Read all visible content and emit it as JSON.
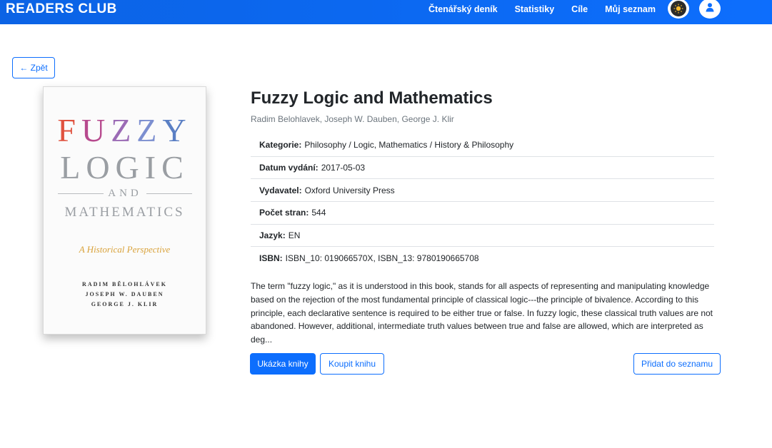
{
  "nav": {
    "brand": "READERS CLUB",
    "links": [
      "Čtenářský deník",
      "Statistiky",
      "Cíle",
      "Můj seznam"
    ]
  },
  "back_label": "← Zpět",
  "cover": {
    "word1": "FUZZY",
    "word2": "LOGIC",
    "word3": "AND",
    "word4": "MATHEMATICS",
    "subtitle": "A Historical Perspective",
    "authors": [
      "RADIM BĚLOHLÁVEK",
      "JOSEPH W. DAUBEN",
      "GEORGE J. KLIR"
    ]
  },
  "book": {
    "title": "Fuzzy Logic and Mathematics",
    "authors": "Radim Belohlavek, Joseph W. Dauben, George J. Klir",
    "details": [
      {
        "label": "Kategorie:",
        "value": "Philosophy / Logic, Mathematics / History & Philosophy"
      },
      {
        "label": "Datum vydání:",
        "value": "2017-05-03"
      },
      {
        "label": "Vydavatel:",
        "value": "Oxford University Press"
      },
      {
        "label": "Počet stran:",
        "value": "544"
      },
      {
        "label": "Jazyk:",
        "value": "EN"
      },
      {
        "label": "ISBN:",
        "value": "ISBN_10: 019066570X, ISBN_13: 9780190665708"
      }
    ],
    "description": "The term \"fuzzy logic,\" as it is understood in this book, stands for all aspects of representing and manipulating knowledge based on the rejection of the most fundamental principle of classical logic---the principle of bivalence. According to this principle, each declarative sentence is required to be either true or false. In fuzzy logic, these classical truth values are not abandoned. However, additional, intermediate truth values between true and false are allowed, which are interpreted as deg..."
  },
  "actions": {
    "preview": "Ukázka knihy",
    "buy": "Koupit knihu",
    "add": "Přidat do seznamu"
  },
  "colors": {
    "primary": "#0d6efd",
    "fuzzy_letters": [
      "#e0523f",
      "#b74a8e",
      "#9b6bb5",
      "#7c8fd0",
      "#5a7fc4"
    ]
  }
}
